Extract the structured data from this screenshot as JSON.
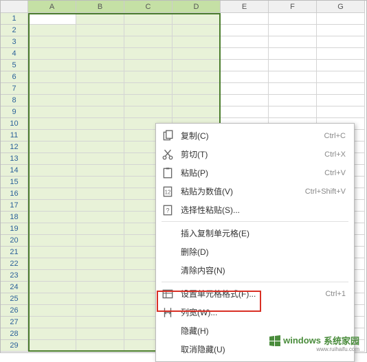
{
  "columns": [
    "A",
    "B",
    "C",
    "D",
    "E",
    "F",
    "G"
  ],
  "selected_columns": [
    "A",
    "B",
    "C",
    "D"
  ],
  "visible_rows": 29,
  "active_cell": {
    "row": 1,
    "col": "A"
  },
  "context_menu": {
    "items": [
      {
        "icon": "copy",
        "label": "复制(C)",
        "shortcut": "Ctrl+C"
      },
      {
        "icon": "cut",
        "label": "剪切(T)",
        "shortcut": "Ctrl+X"
      },
      {
        "icon": "paste",
        "label": "粘贴(P)",
        "shortcut": "Ctrl+V"
      },
      {
        "icon": "paste-values",
        "label": "粘贴为数值(V)",
        "shortcut": "Ctrl+Shift+V"
      },
      {
        "icon": "paste-special",
        "label": "选择性粘贴(S)...",
        "shortcut": ""
      },
      {
        "separator": true
      },
      {
        "icon": "",
        "label": "插入复制单元格(E)",
        "shortcut": ""
      },
      {
        "icon": "",
        "label": "删除(D)",
        "shortcut": ""
      },
      {
        "icon": "",
        "label": "清除内容(N)",
        "shortcut": ""
      },
      {
        "separator": true
      },
      {
        "icon": "format-cells",
        "label": "设置单元格格式(F)...",
        "shortcut": "Ctrl+1"
      },
      {
        "icon": "column-width",
        "label": "列宽(W)...",
        "shortcut": ""
      },
      {
        "icon": "",
        "label": "隐藏(H)",
        "shortcut": ""
      },
      {
        "icon": "",
        "label": "取消隐藏(U)",
        "shortcut": ""
      }
    ]
  },
  "watermark": {
    "brand": "windows",
    "suffix": "系统家园",
    "url": "www.ruihaifu.com"
  }
}
